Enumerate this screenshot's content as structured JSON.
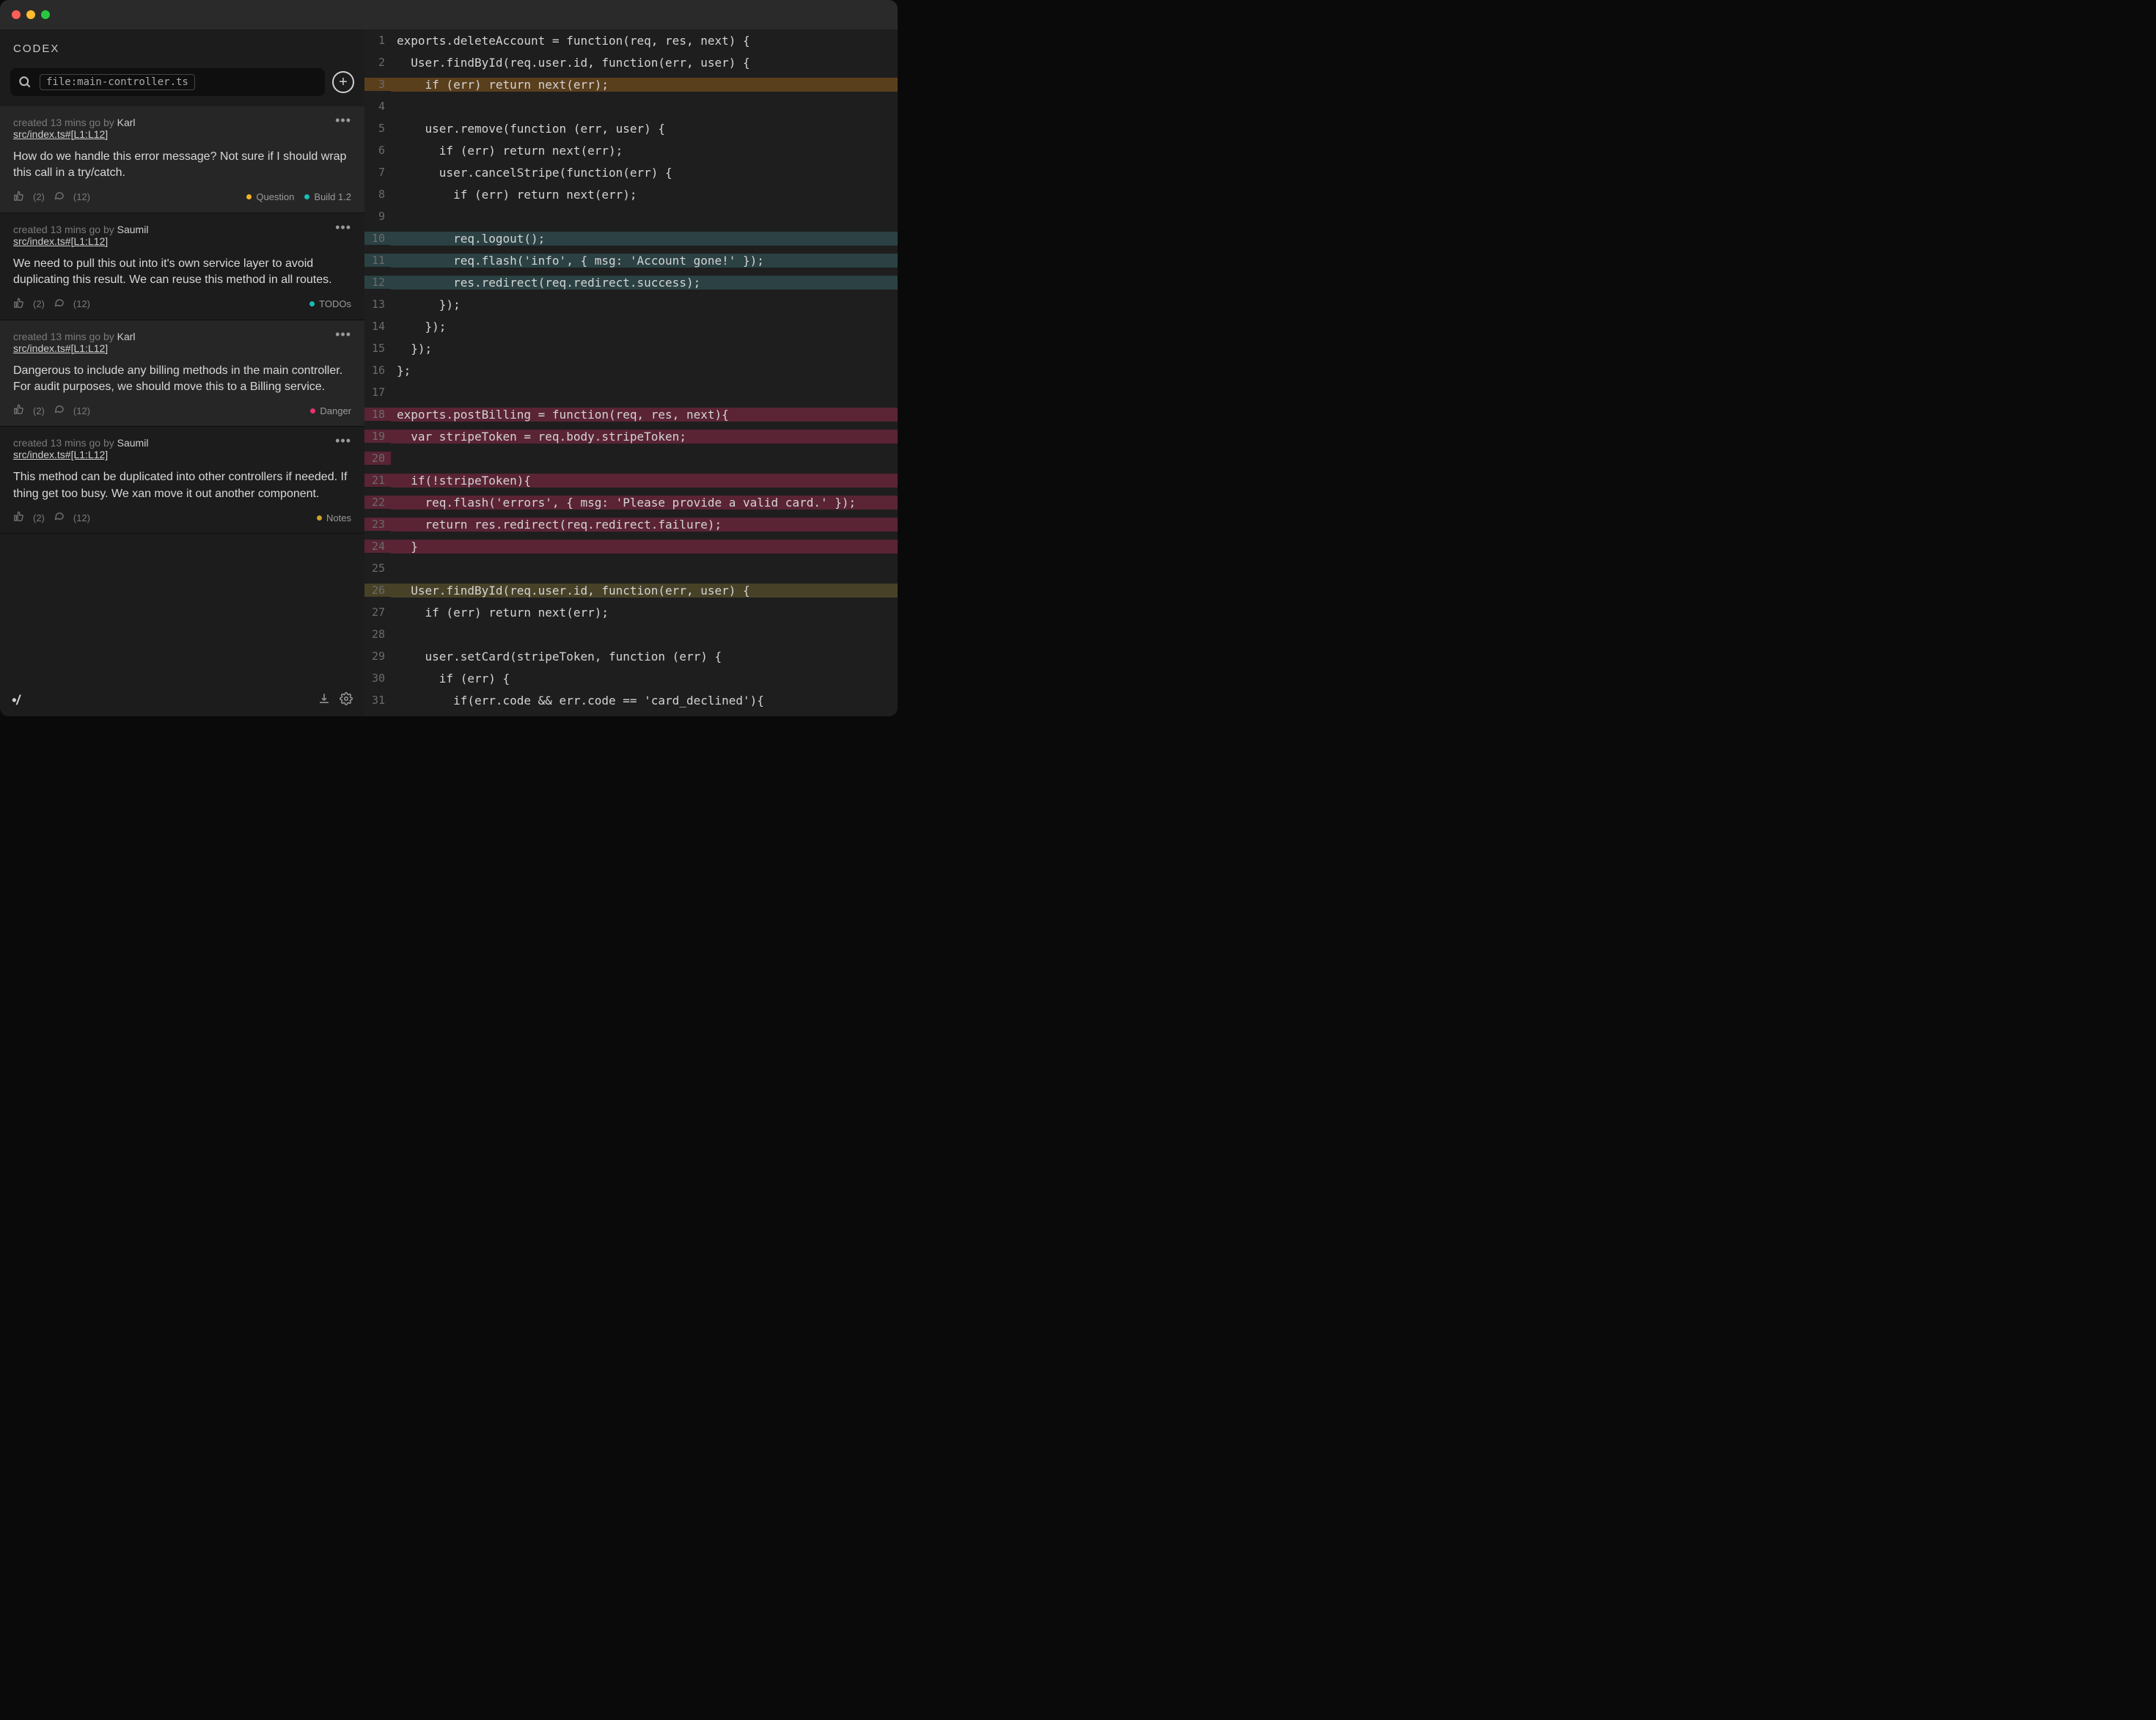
{
  "brand": "CODEX",
  "search": {
    "chip": "file:main-controller.ts"
  },
  "tag_colors": {
    "Question": "#f0b429",
    "Build 1.2": "#1bbcb6",
    "TODOs": "#1bbcb6",
    "Danger": "#e8316e",
    "Notes": "#c9a227"
  },
  "items": [
    {
      "when": "created 13 mins go by ",
      "author": "Karl",
      "ref": "src/index.ts#[L1:L12]",
      "msg": "How do we handle this error message? Not sure if I should wrap this call in a try/catch.",
      "likes": "(2)",
      "comments": "(12)",
      "tags": [
        "Question",
        "Build 1.2"
      ],
      "alt": true
    },
    {
      "when": "created 13 mins go by ",
      "author": "Saumil",
      "ref": "src/index.ts#[L1:L12]",
      "msg": "We need to pull this out into it's own service layer to avoid duplicating this result. We can reuse this method in all routes.",
      "likes": "(2)",
      "comments": "(12)",
      "tags": [
        "TODOs"
      ],
      "alt": false
    },
    {
      "when": "created 13 mins go by ",
      "author": "Karl",
      "ref": "src/index.ts#[L1:L12]",
      "msg": "Dangerous to include any billing methods in the main controller. For audit purposes, we should move this to a Billing service.",
      "likes": "(2)",
      "comments": "(12)",
      "tags": [
        "Danger"
      ],
      "alt": true
    },
    {
      "when": "created 13 mins go by ",
      "author": "Saumil",
      "ref": "src/index.ts#[L1:L12]",
      "msg": "This method can be duplicated into other controllers if needed. If thing get too busy. We xan move it out another component.",
      "likes": "(2)",
      "comments": "(12)",
      "tags": [
        "Notes"
      ],
      "alt": false
    }
  ],
  "code": [
    {
      "n": 1,
      "hl": "",
      "t": "exports.deleteAccount = function(req, res, next) {"
    },
    {
      "n": 2,
      "hl": "",
      "t": "  User.findById(req.user.id, function(err, user) {"
    },
    {
      "n": 3,
      "hl": "a",
      "t": "    if (err) return next(err);"
    },
    {
      "n": 4,
      "hl": "",
      "t": ""
    },
    {
      "n": 5,
      "hl": "",
      "t": "    user.remove(function (err, user) {"
    },
    {
      "n": 6,
      "hl": "",
      "t": "      if (err) return next(err);"
    },
    {
      "n": 7,
      "hl": "",
      "t": "      user.cancelStripe(function(err) {"
    },
    {
      "n": 8,
      "hl": "",
      "t": "        if (err) return next(err);"
    },
    {
      "n": 9,
      "hl": "",
      "t": ""
    },
    {
      "n": 10,
      "hl": "b",
      "t": "        req.logout();"
    },
    {
      "n": 11,
      "hl": "b",
      "t": "        req.flash('info', { msg: 'Account gone!' });"
    },
    {
      "n": 12,
      "hl": "b",
      "t": "        res.redirect(req.redirect.success);"
    },
    {
      "n": 13,
      "hl": "",
      "t": "      });"
    },
    {
      "n": 14,
      "hl": "",
      "t": "    });"
    },
    {
      "n": 15,
      "hl": "",
      "t": "  });"
    },
    {
      "n": 16,
      "hl": "",
      "t": "};"
    },
    {
      "n": 17,
      "hl": "",
      "t": ""
    },
    {
      "n": 18,
      "hl": "c",
      "t": "exports.postBilling = function(req, res, next){"
    },
    {
      "n": 19,
      "hl": "c",
      "t": "  var stripeToken = req.body.stripeToken;"
    },
    {
      "n": 20,
      "hl": "c",
      "t": ""
    },
    {
      "n": 21,
      "hl": "c",
      "t": "  if(!stripeToken){"
    },
    {
      "n": 22,
      "hl": "c",
      "t": "    req.flash('errors', { msg: 'Please provide a valid card.' });"
    },
    {
      "n": 23,
      "hl": "c",
      "t": "    return res.redirect(req.redirect.failure);"
    },
    {
      "n": 24,
      "hl": "c",
      "t": "  }"
    },
    {
      "n": 25,
      "hl": "",
      "t": ""
    },
    {
      "n": 26,
      "hl": "d",
      "t": "  User.findById(req.user.id, function(err, user) {"
    },
    {
      "n": 27,
      "hl": "",
      "t": "    if (err) return next(err);"
    },
    {
      "n": 28,
      "hl": "",
      "t": ""
    },
    {
      "n": 29,
      "hl": "",
      "t": "    user.setCard(stripeToken, function (err) {"
    },
    {
      "n": 30,
      "hl": "",
      "t": "      if (err) {"
    },
    {
      "n": 31,
      "hl": "",
      "t": "        if(err.code && err.code == 'card_declined'){"
    }
  ],
  "footer_logo": "•/"
}
